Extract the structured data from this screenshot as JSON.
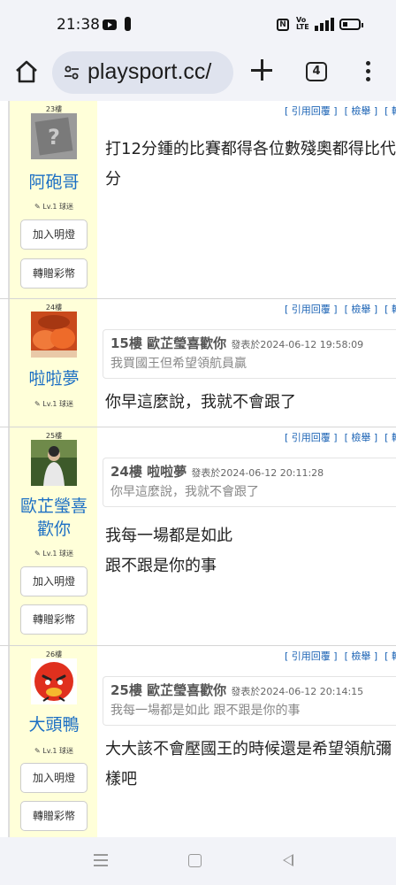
{
  "status_bar": {
    "time": "21:38",
    "network": "4G"
  },
  "browser": {
    "url": "playsport.cc/",
    "tab_count": "4"
  },
  "post_actions": {
    "quote_reply": "[ 引用回覆 ]",
    "report": "[ 檢舉 ]",
    "more": "[ 轉"
  },
  "posts": [
    {
      "floor": "23樓",
      "username": "阿砲哥",
      "level": "Lv.1 球迷",
      "add_fan_label": "加入明燈",
      "gift_label": "轉贈彩幣",
      "lines": [
        "打12分鍾的比賽都得各位數殘奧都得比代",
        "分"
      ]
    },
    {
      "floor": "24樓",
      "username": "啦啦夢",
      "level": "Lv.1 球迷",
      "quote": {
        "title": "15樓 歐芷瑩喜歡你",
        "time": "發表於2024-06-12 19:58:09",
        "text": "我買國王但希望領航員贏"
      },
      "lines": [
        "你早這麼說，我就不會跟了"
      ]
    },
    {
      "floor": "25樓",
      "username_line1": "歐芷瑩喜",
      "username_line2": "歡你",
      "level": "Lv.1 球迷",
      "add_fan_label": "加入明燈",
      "gift_label": "轉贈彩幣",
      "quote": {
        "title": "24樓 啦啦夢",
        "time": "發表於2024-06-12 20:11:28",
        "text": "你早這麼說，我就不會跟了"
      },
      "lines": [
        "我每一場都是如此",
        "跟不跟是你的事"
      ]
    },
    {
      "floor": "26樓",
      "username": "大頭鴨",
      "level": "Lv.1 球迷",
      "add_fan_label": "加入明燈",
      "gift_label": "轉贈彩幣",
      "quote": {
        "title": "25樓 歐芷瑩喜歡你",
        "time": "發表於2024-06-12 20:14:15",
        "text": "我每一場都是如此 跟不跟是你的事"
      },
      "lines": [
        "大大該不會壓國王的時候還是希望領航彌",
        "樣吧"
      ]
    }
  ],
  "colors": {
    "profile_bg": "#ffffd9",
    "username": "#1c6fc4",
    "action_link": "#1b63b5",
    "chrome_bg": "#f2f3f8"
  }
}
